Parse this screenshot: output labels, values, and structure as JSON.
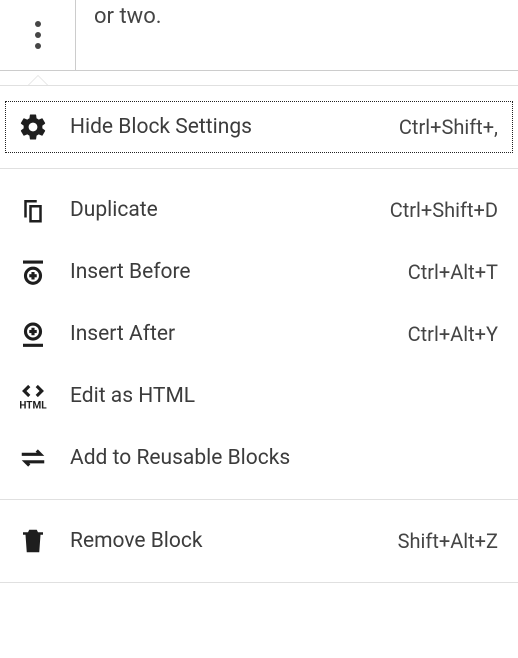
{
  "editor": {
    "visible_text": "or two."
  },
  "menu": {
    "groups": [
      {
        "items": [
          {
            "id": "hide-settings",
            "icon": "gear",
            "label": "Hide Block Settings",
            "shortcut": "Ctrl+Shift+,",
            "focused": true
          }
        ]
      },
      {
        "items": [
          {
            "id": "duplicate",
            "icon": "duplicate",
            "label": "Duplicate",
            "shortcut": "Ctrl+Shift+D"
          },
          {
            "id": "insert-before",
            "icon": "insert-before",
            "label": "Insert Before",
            "shortcut": "Ctrl+Alt+T"
          },
          {
            "id": "insert-after",
            "icon": "insert-after",
            "label": "Insert After",
            "shortcut": "Ctrl+Alt+Y"
          },
          {
            "id": "edit-html",
            "icon": "html",
            "label": "Edit as HTML",
            "shortcut": ""
          },
          {
            "id": "add-reusable",
            "icon": "reusable",
            "label": "Add to Reusable Blocks",
            "shortcut": ""
          }
        ]
      },
      {
        "items": [
          {
            "id": "remove-block",
            "icon": "trash",
            "label": "Remove Block",
            "shortcut": "Shift+Alt+Z"
          }
        ]
      }
    ]
  }
}
